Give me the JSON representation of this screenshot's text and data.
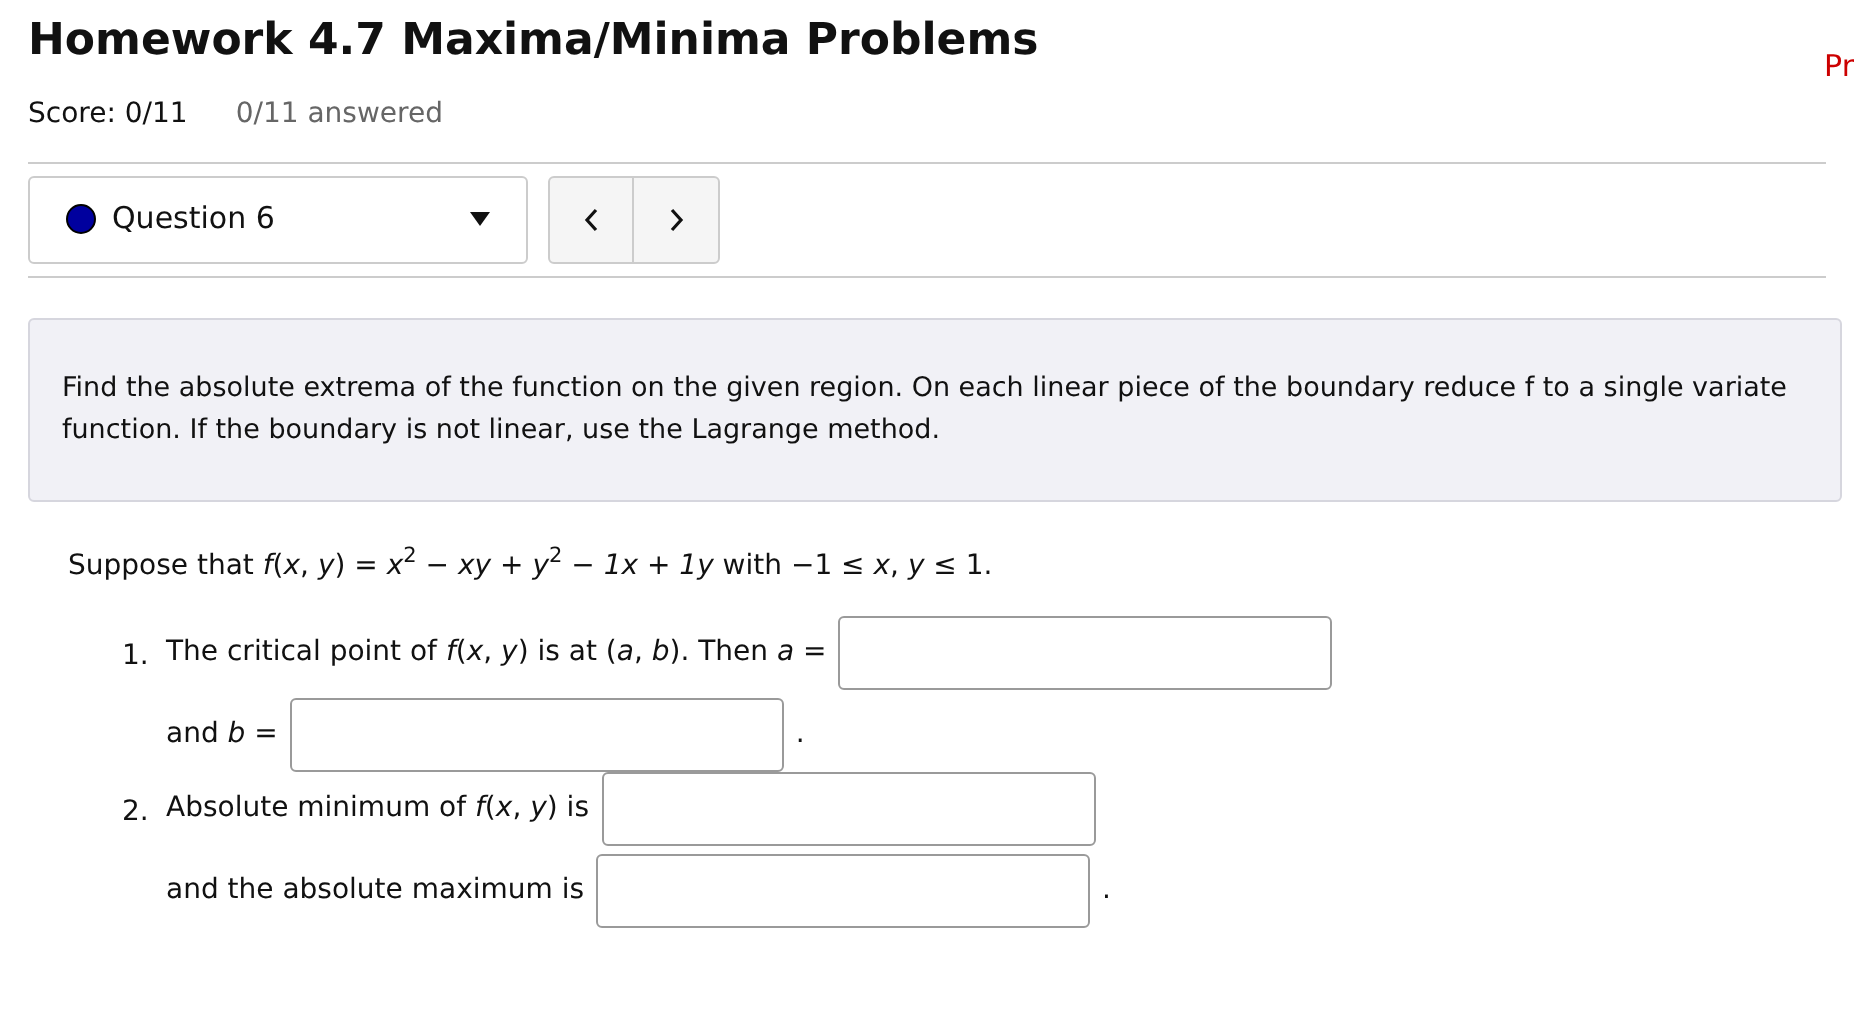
{
  "title": "Homework 4.7 Maxima/Minima Problems",
  "corner_link": "Pr",
  "score": "Score: 0/11",
  "answered": "0/11 answered",
  "question_select": {
    "label": "Question 6"
  },
  "instructions": "Find the absolute extrema of the function on the given region. On each linear piece of the boundary reduce f to a single variate function. If the boundary is not linear, use the Lagrange method.",
  "prompt": "Suppose that *f*(*x*, *y*) = *x*$^{2}$ − *xy* + *y*$^{2}$ − *1x* + *1y* with −1 ≤ *x*, *y* ≤ 1.",
  "parts": [
    {
      "number": "1.",
      "lines": [
        [
          {
            "kind": "text",
            "text": "The critical point of *f*(*x*, *y*) is at (*a*, *b*). Then *a* ="
          },
          {
            "kind": "field"
          }
        ],
        [
          {
            "kind": "text",
            "text": "and *b* ="
          },
          {
            "kind": "field"
          },
          {
            "kind": "text",
            "text": "."
          }
        ]
      ]
    },
    {
      "number": "2.",
      "lines": [
        [
          {
            "kind": "text",
            "text": "Absolute minimum of *f*(*x*, *y*) is"
          },
          {
            "kind": "field"
          }
        ],
        [
          {
            "kind": "text",
            "text": "and the absolute maximum is"
          },
          {
            "kind": "field"
          },
          {
            "kind": "text",
            "text": "."
          }
        ]
      ]
    }
  ]
}
